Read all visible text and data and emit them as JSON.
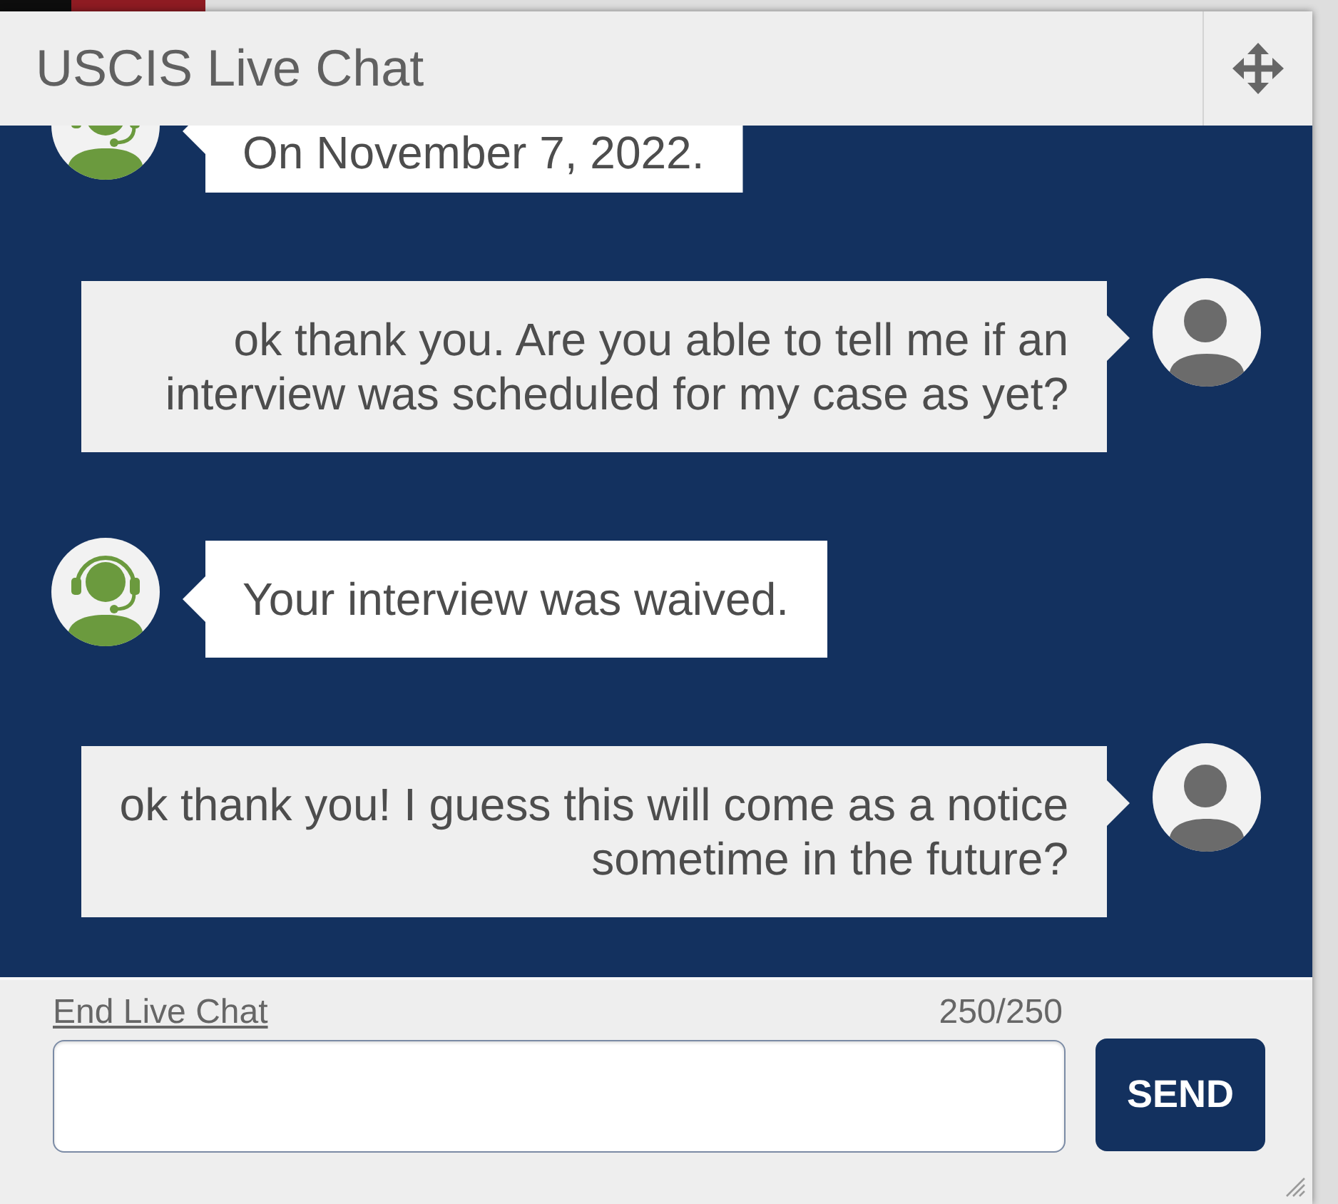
{
  "window": {
    "title": "USCIS Live Chat"
  },
  "messages": [
    {
      "kind": "agent",
      "text": "On November 7, 2022."
    },
    {
      "kind": "user",
      "text": "ok thank you. Are you able to tell me if an interview was scheduled for my case as yet?"
    },
    {
      "kind": "agent",
      "text": "Your interview was waived."
    },
    {
      "kind": "user",
      "text": "ok thank you! I guess this will come as a notice sometime in the future?"
    }
  ],
  "footer": {
    "end_chat_link": "End Live Chat",
    "char_count": "250/250",
    "send_button": "SEND"
  }
}
